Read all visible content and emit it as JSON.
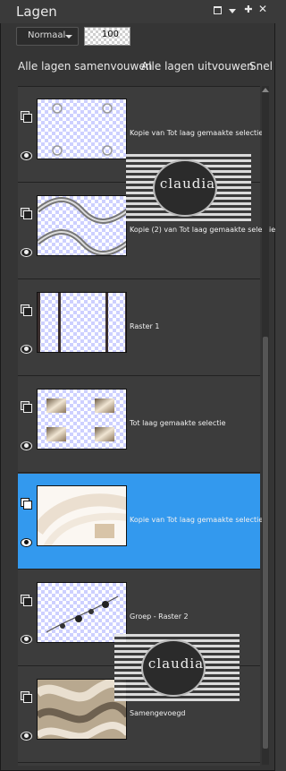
{
  "panel": {
    "title": "Lagen",
    "blend_mode": "Normaal",
    "opacity": "100",
    "actions": [
      "Alle lagen samenvouwen",
      "Alle lagen uitvouwen",
      "Snel"
    ]
  },
  "layers": [
    {
      "name": "Kopie van Tot laag gemaakte selectie",
      "selected": false,
      "thumb": "corner-ornaments"
    },
    {
      "name": "Kopie (2) van Tot laag gemaakte selectie",
      "selected": false,
      "thumb": "wave-bands"
    },
    {
      "name": "Raster 1",
      "selected": false,
      "thumb": "vertical-bars"
    },
    {
      "name": "Tot laag gemaakte selectie",
      "selected": false,
      "thumb": "gold-tiles"
    },
    {
      "name": "Kopie van Tot laag gemaakte selectie",
      "selected": true,
      "thumb": "soft-swirl"
    },
    {
      "name": "Groep - Raster 2",
      "selected": false,
      "thumb": "beads"
    },
    {
      "name": "Samengevoegd",
      "selected": false,
      "thumb": "marble"
    }
  ],
  "watermark": {
    "text": "claudia"
  },
  "colors": {
    "selection": "#3399ee",
    "panel_bg": "#3c3c3c"
  },
  "icons": {
    "layer": "layer-stack-icon",
    "visibility": "eye-icon"
  }
}
